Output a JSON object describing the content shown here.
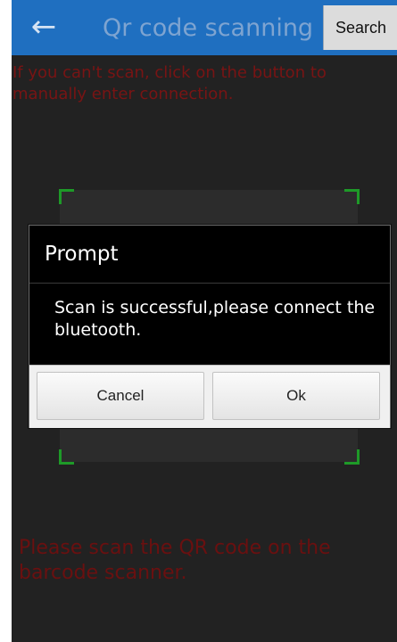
{
  "header": {
    "back_icon": "arrow-left-icon",
    "title": "Qr code scanning",
    "search_label": "Search",
    "bg_color": "#1f6fc0"
  },
  "hints": {
    "top": "If you can't scan, click on the button to manually enter connection.",
    "bottom": "Please scan the QR code on the barcode scanner."
  },
  "dialog": {
    "title": "Prompt",
    "message": "Scan is successful,please connect the bluetooth.",
    "cancel_label": "Cancel",
    "ok_label": "Ok"
  },
  "colors": {
    "hint_text": "#781414",
    "scan_corner": "#1e9a28"
  }
}
